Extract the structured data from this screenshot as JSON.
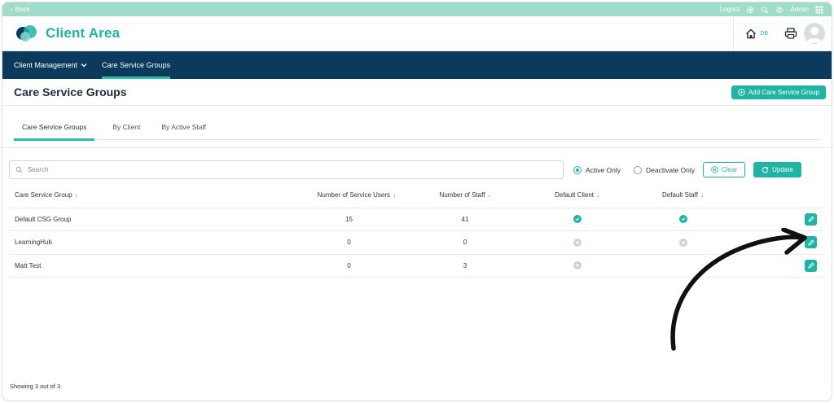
{
  "topbar": {
    "back_label": "Back",
    "logout_label": "Logout",
    "admin_label": "Admin"
  },
  "header": {
    "title": "Client Area",
    "user_initials": "DB"
  },
  "nav": {
    "items": [
      {
        "label": "Client Management"
      },
      {
        "label": "Care Service Groups"
      }
    ]
  },
  "page": {
    "title": "Care Service Groups",
    "add_button": "Add Care Service Group"
  },
  "tabs": [
    {
      "label": "Care Service Groups"
    },
    {
      "label": "By Client"
    },
    {
      "label": "By Active Staff"
    }
  ],
  "filters": {
    "search_placeholder": "Search",
    "active_only": "Active Only",
    "deactivate_only": "Deactivate Only",
    "clear": "Clear",
    "update": "Update",
    "selected": "Active Only"
  },
  "table": {
    "columns": [
      "Care Service Group",
      "Number of Service Users",
      "Number of Staff",
      "Default Client",
      "Default Staff"
    ],
    "rows": [
      {
        "name": "Default CSG Group",
        "service_users": "15",
        "staff": "41",
        "default_client": true,
        "default_staff": true
      },
      {
        "name": "LearningHub",
        "service_users": "0",
        "staff": "0",
        "default_client": false,
        "default_staff": false
      },
      {
        "name": "Matt Test",
        "service_users": "0",
        "staff": "3",
        "default_client": false,
        "default_staff": null
      }
    ]
  },
  "footer": {
    "showing": "Showing 3 out of 3"
  },
  "colors": {
    "accent": "#1fb5a5",
    "nav_bg": "#0b3a5c",
    "topbar_bg": "#9fdcc9"
  }
}
